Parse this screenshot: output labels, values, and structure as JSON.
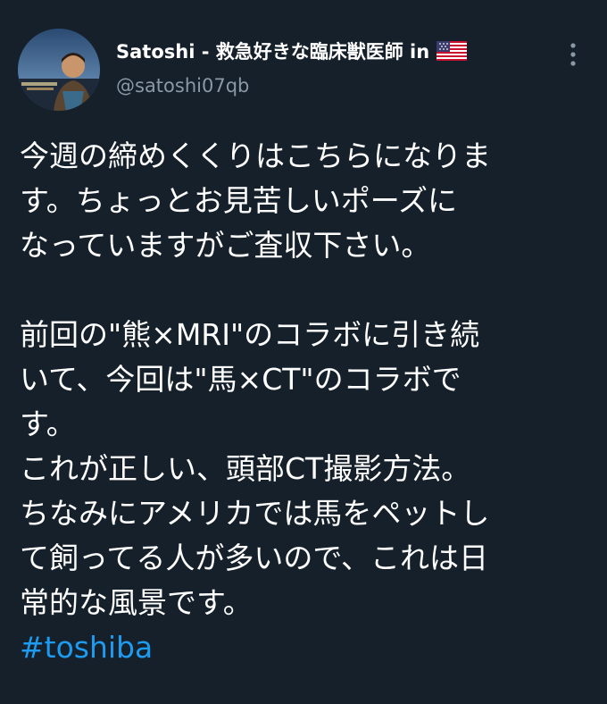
{
  "tweet": {
    "author_name": "Satoshi - 救急好きな臨床獣医師 in",
    "flag_icon": "us-flag-icon",
    "handle": "@satoshi07qb",
    "more_icon": "more-vertical-icon",
    "paragraph1": [
      "今週の締めくくりはこちらになりま",
      "す。ちょっとお見苦しいポーズに",
      "なっていますがご査収下さい。"
    ],
    "paragraph2": [
      "前回の\"熊×MRI\"のコラボに引き続",
      "いて、今回は\"馬×CT\"のコラボで",
      "す。",
      "これが正しい、頭部CT撮影方法。",
      "ちなみにアメリカでは馬をペットし",
      "て飼ってる人が多いので、これは日",
      "常的な風景です。"
    ],
    "hashtag": "#toshiba"
  },
  "colors": {
    "background": "#15202b",
    "text": "#ffffff",
    "secondary_text": "#8b98a5",
    "link": "#1d9bf0"
  }
}
